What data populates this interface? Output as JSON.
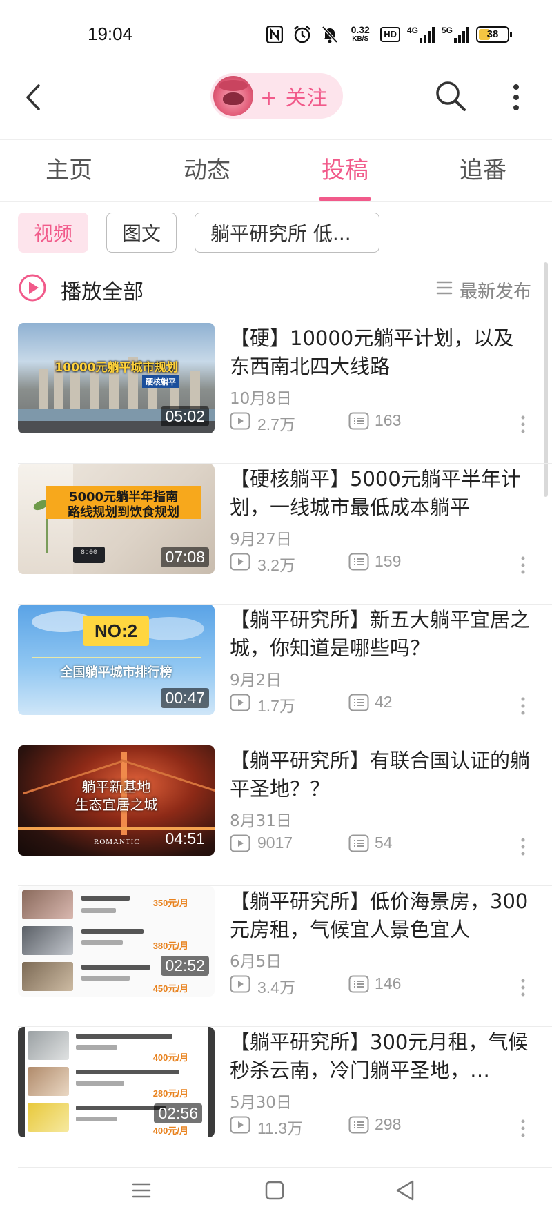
{
  "status_bar": {
    "time": "19:04",
    "speed_value": "0.32",
    "speed_unit": "KB/S",
    "hd_tag": "HD",
    "network_1": "4G",
    "network_2": "5G",
    "battery": "38"
  },
  "header": {
    "follow_label": "+ 关注"
  },
  "tabs": [
    {
      "label": "主页",
      "active": false
    },
    {
      "label": "动态",
      "active": false
    },
    {
      "label": "投稿",
      "active": true
    },
    {
      "label": "追番",
      "active": false
    }
  ],
  "chips": [
    {
      "label": "视频",
      "active": true
    },
    {
      "label": "图文",
      "active": false
    },
    {
      "label": "躺平研究所 低...",
      "active": false
    }
  ],
  "playbar": {
    "play_all": "播放全部",
    "sort": "最新发布"
  },
  "videos": [
    {
      "title": "【硬】10000元躺平计划，以及东西南北四大线路",
      "date": "10月8日",
      "plays": "2.7万",
      "comments": "163",
      "duration": "05:02",
      "thumb_caption": "10000元躺平城市规划",
      "thumb_tag": "硬核躺平"
    },
    {
      "title": "【硬核躺平】5000元躺平半年计划，一线城市最低成本躺平",
      "date": "9月27日",
      "plays": "3.2万",
      "comments": "159",
      "duration": "07:08",
      "thumb_caption_1": "5000元躺半年指南",
      "thumb_caption_2": "路线规划到饮食规划",
      "thumb_clock": "8:00"
    },
    {
      "title": "【躺平研究所】新五大躺平宜居之城，你知道是哪些吗？",
      "date": "9月2日",
      "plays": "1.7万",
      "comments": "42",
      "duration": "00:47",
      "thumb_badge": "NO:2",
      "thumb_caption": "全国躺平城市排行榜"
    },
    {
      "title": "【躺平研究所】有联合国认证的躺平圣地？？",
      "date": "8月31日",
      "plays": "9017",
      "comments": "54",
      "duration": "04:51",
      "thumb_caption_1": "躺平新基地",
      "thumb_caption_2": "生态宜居之城",
      "thumb_logo": "ROMANTIC"
    },
    {
      "title": "【躺平研究所】低价海景房，300元房租，气候宜人景色宜人",
      "date": "6月5日",
      "plays": "3.4万",
      "comments": "146",
      "duration": "02:52",
      "thumb_prices": [
        "350元/月",
        "380元/月",
        "450元/月"
      ]
    },
    {
      "title": "【躺平研究所】300元月租，气候秒杀云南，冷门躺平圣地，…",
      "date": "5月30日",
      "plays": "11.3万",
      "comments": "298",
      "duration": "02:56",
      "thumb_prices": [
        "400元/月",
        "280元/月",
        "400元/月"
      ]
    }
  ],
  "colors": {
    "accent": "#f15a8a",
    "accent_bg": "#fde4ec",
    "muted": "#999999"
  }
}
